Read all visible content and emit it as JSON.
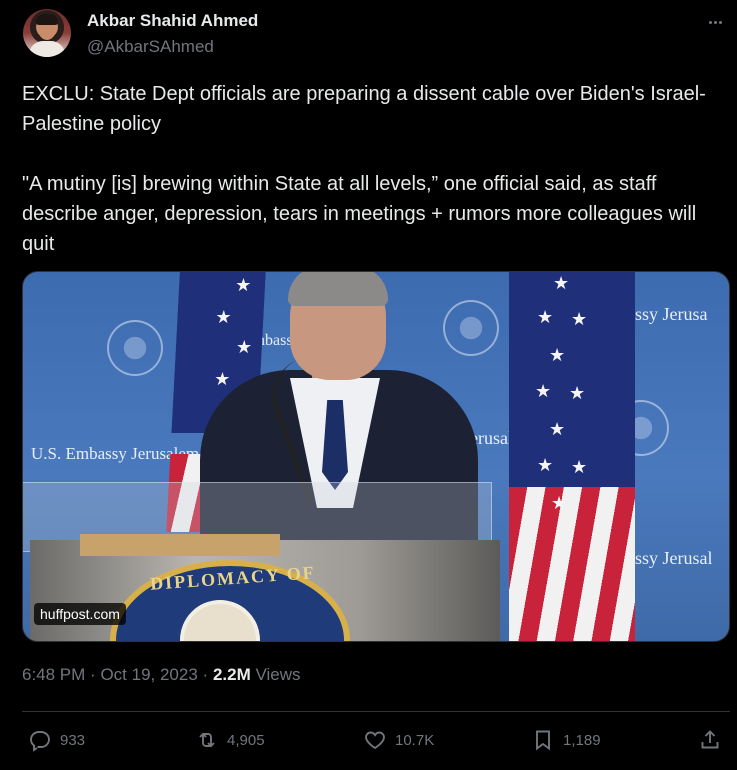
{
  "author": {
    "name": "Akbar Shahid Ahmed",
    "handle": "@AkbarSAhmed"
  },
  "tweet": {
    "paragraph1": "EXCLU: State Dept officials are preparing a dissent cable over Biden's Israel-Palestine policy",
    "paragraph2": "\"A mutiny [is] brewing within State at all levels,” one official said, as staff describe anger, depression, tears in meetings + rumors more colleagues will quit"
  },
  "media": {
    "source_label": "huffpost.com",
    "wall_text_left": "U.S. Embassy Jerusalem",
    "wall_text_right_top": "Embassy Jerusa",
    "wall_text_right_bottom": "assy Jerusal",
    "wall_text_mid1": "nbass",
    "wall_text_mid2": "Jerusale",
    "podium_text": "DIPLOMACY OF"
  },
  "meta": {
    "time": "6:48 PM",
    "date": "Oct 19, 2023",
    "separator": "·",
    "views_count": "2.2M",
    "views_label": "Views"
  },
  "actions": {
    "replies": "933",
    "reposts": "4,905",
    "likes": "10.7K",
    "bookmarks": "1,189"
  },
  "icons": [
    "more-icon",
    "reply-icon",
    "repost-icon",
    "like-icon",
    "bookmark-icon",
    "share-icon"
  ],
  "colors": {
    "background": "#000000",
    "text_primary": "#e7e9ea",
    "text_secondary": "#71767b",
    "divider": "#2f3336"
  }
}
